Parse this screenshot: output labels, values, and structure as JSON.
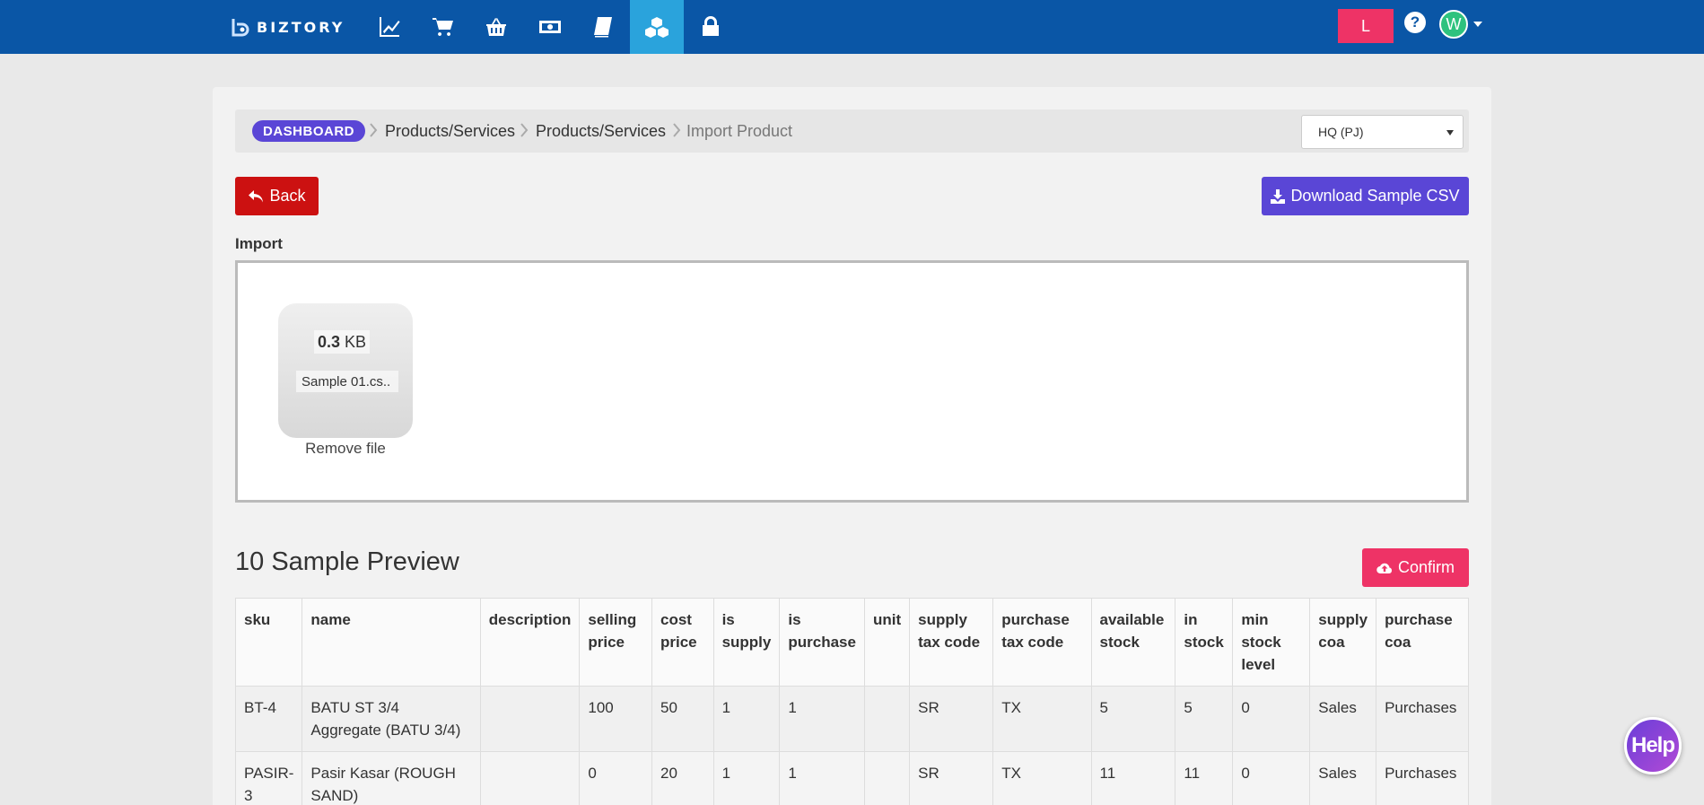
{
  "app": {
    "brand": "BIZTORY"
  },
  "nav": {
    "icons": [
      "chart-line-icon",
      "shopping-cart-icon",
      "basket-icon",
      "money-icon",
      "book-icon",
      "cubes-icon",
      "lock-icon"
    ],
    "active": "cubes-icon",
    "user_initial": "L",
    "avatar_initial": "W"
  },
  "breadcrumb": {
    "home": "DASHBOARD",
    "items": [
      "Products/Services",
      "Products/Services",
      "Import Product"
    ]
  },
  "branch_select": {
    "value": "HQ (PJ)"
  },
  "buttons": {
    "back": "Back",
    "download": "Download Sample CSV",
    "confirm": "Confirm"
  },
  "import": {
    "label": "Import",
    "file": {
      "size_value": "0.3",
      "size_unit": "KB",
      "name": "Sample 01.cs..",
      "remove": "Remove file"
    }
  },
  "preview": {
    "title": "10 Sample Preview",
    "columns": [
      "sku",
      "name",
      "description",
      "selling price",
      "cost price",
      "is supply",
      "is purchase",
      "unit",
      "supply tax code",
      "purchase tax code",
      "available stock",
      "in stock",
      "min stock level",
      "supply coa",
      "purchase coa"
    ],
    "rows": [
      [
        "BT-4",
        "BATU ST 3/4 Aggregate (BATU 3/4)",
        "",
        "100",
        "50",
        "1",
        "1",
        "",
        "SR",
        "TX",
        "5",
        "5",
        "0",
        "Sales",
        "Purchases"
      ],
      [
        "PASIR-3",
        "Pasir Kasar (ROUGH SAND)",
        "",
        "0",
        "20",
        "1",
        "1",
        "",
        "SR",
        "TX",
        "11",
        "11",
        "0",
        "Sales",
        "Purchases"
      ]
    ]
  },
  "help_widget": {
    "label": "Help"
  },
  "colors": {
    "navbar": "#0a56a6",
    "active_tab": "#2aa3dc",
    "primary": "#5a46d6",
    "danger": "#cc1111",
    "pink": "#ee3366"
  }
}
